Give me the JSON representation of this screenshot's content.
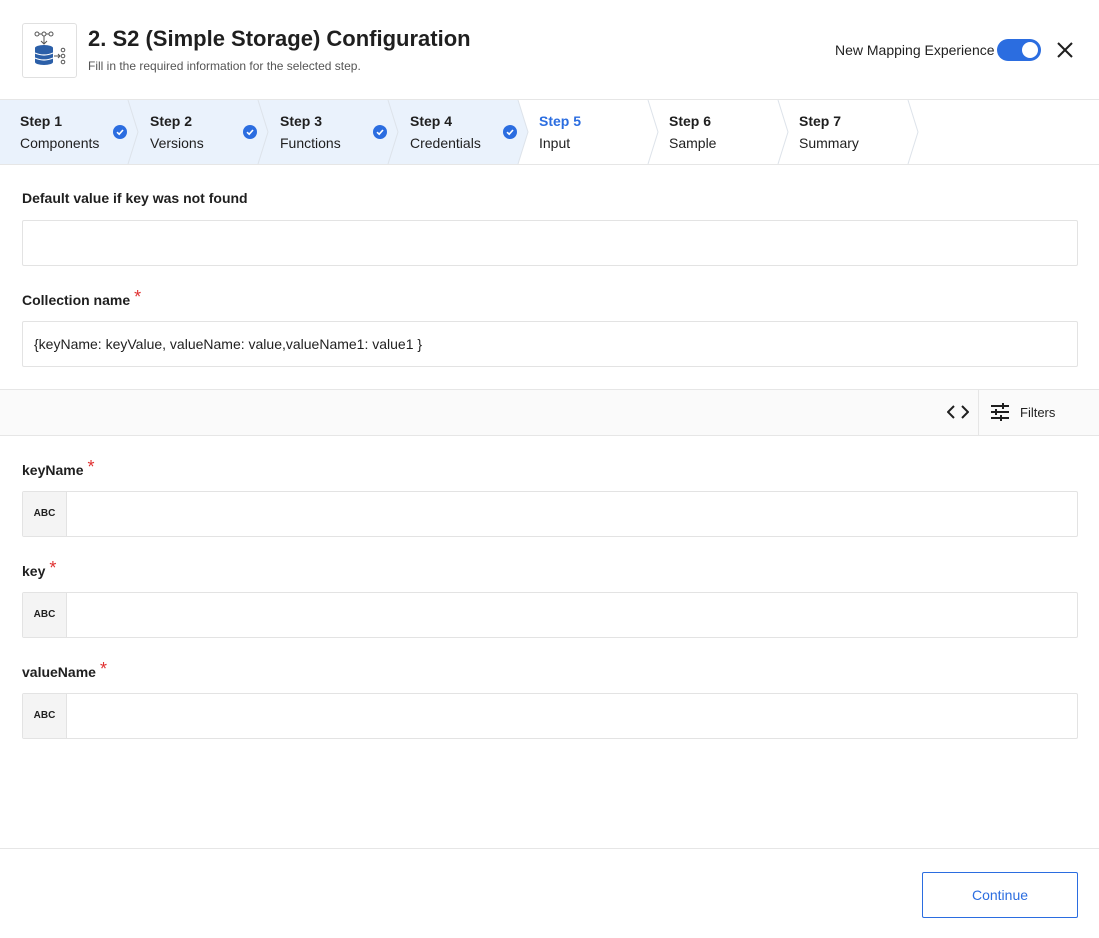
{
  "header": {
    "title": "2. S2 (Simple Storage) Configuration",
    "subtitle": "Fill in the required information for the selected step.",
    "toggle_label": "New Mapping Experience",
    "toggle_on": true,
    "app_icon": "database-flow-icon",
    "close_icon": "close-icon"
  },
  "stepper": {
    "steps": [
      {
        "num": "Step 1",
        "name": "Components",
        "done": true
      },
      {
        "num": "Step 2",
        "name": "Versions",
        "done": true
      },
      {
        "num": "Step 3",
        "name": "Functions",
        "done": true
      },
      {
        "num": "Step 4",
        "name": "Credentials",
        "done": true
      },
      {
        "num": "Step 5",
        "name": "Input",
        "active": true
      },
      {
        "num": "Step 6",
        "name": "Sample"
      },
      {
        "num": "Step 7",
        "name": "Summary"
      }
    ]
  },
  "form": {
    "default_value": {
      "label": "Default value if key was not found",
      "value": ""
    },
    "collection_name": {
      "label": "Collection name",
      "required_mark": "*",
      "value": "{keyName: keyValue, valueName: value,valueName1: value1 }"
    }
  },
  "toolbar": {
    "code_icon": "code-brackets-icon",
    "filters_icon": "sliders-icon",
    "filters_label": "Filters"
  },
  "mapping_fields": [
    {
      "label": "keyName",
      "required_mark": "*",
      "type_badge": "ABC",
      "value": ""
    },
    {
      "label": "key",
      "required_mark": "*",
      "type_badge": "ABC",
      "value": ""
    },
    {
      "label": "valueName",
      "required_mark": "*",
      "type_badge": "ABC",
      "value": ""
    }
  ],
  "footer": {
    "continue_label": "Continue"
  },
  "colors": {
    "accent": "#2b6de0",
    "completed_step_bg": "#eaf2fc",
    "required": "#e03131"
  }
}
